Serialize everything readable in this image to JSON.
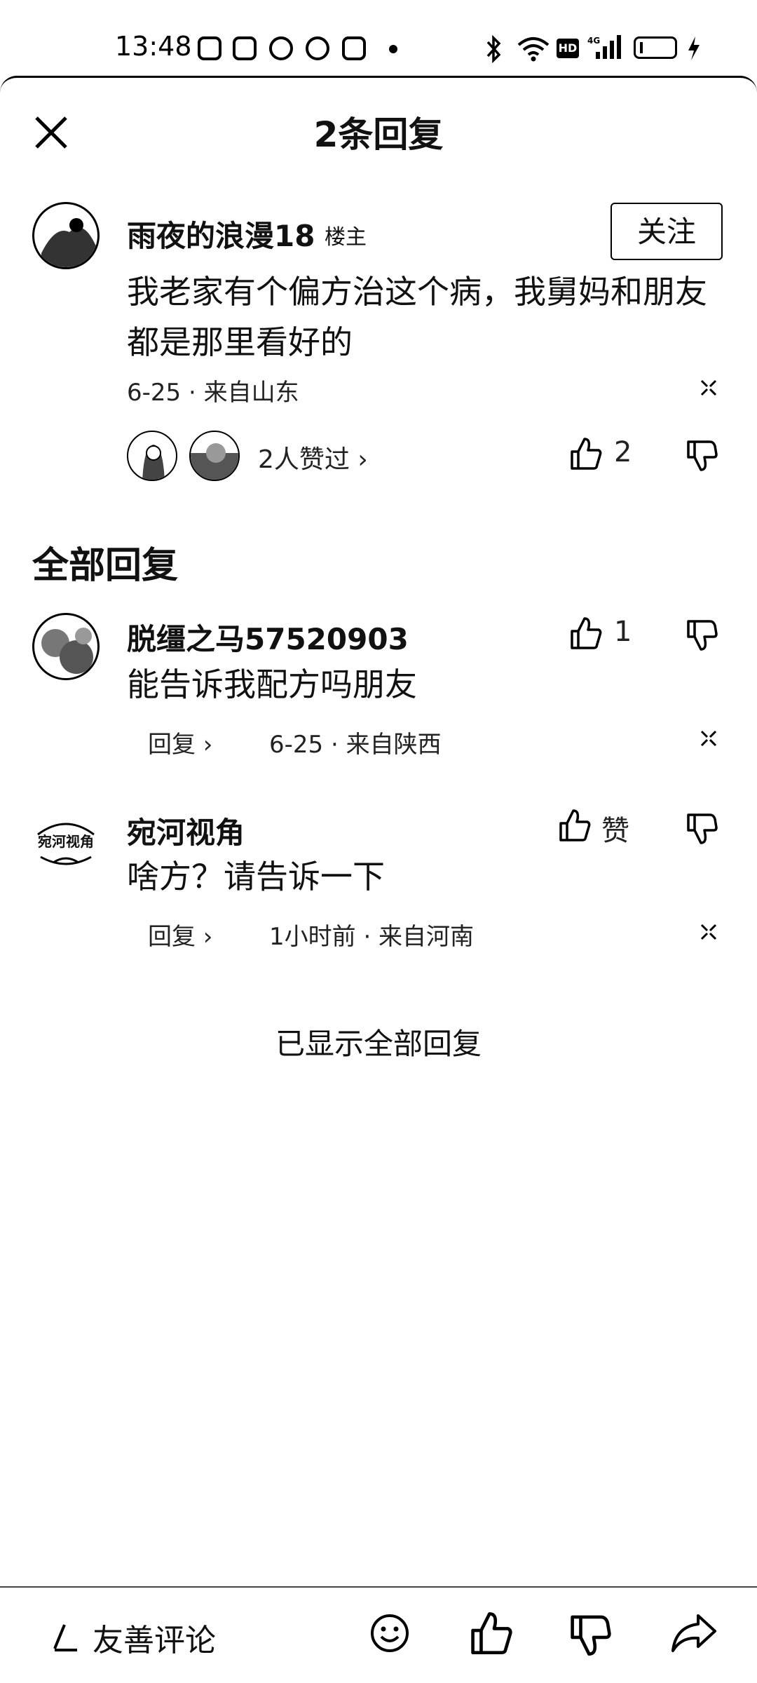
{
  "status_bar": {
    "time": "13:48"
  },
  "header": {
    "title": "2条回复"
  },
  "main_comment": {
    "username": "雨夜的浪漫18",
    "badge": "楼主",
    "follow_label": "关注",
    "text": "我老家有个偏方治这个病，我舅妈和朋友都是那里看好的",
    "meta": "6-25 · 来自山东",
    "liked_by": "2人赞过 ›",
    "like_count": "2"
  },
  "section": {
    "title": "全部回复"
  },
  "replies": [
    {
      "username": "脱缰之马57520903",
      "text": "能告诉我配方吗朋友",
      "reply_label": "回复 ›",
      "meta": "6-25 · 来自陕西",
      "like_count": "1"
    },
    {
      "username": "宛河视角",
      "text": "啥方？请告诉一下",
      "reply_label": "回复 ›",
      "meta": "1小时前 · 来自河南",
      "like_count": "赞",
      "avatar_text": "宛河视角"
    }
  ],
  "footer": {
    "end_note": "已显示全部回复",
    "input_placeholder": "友善评论"
  }
}
